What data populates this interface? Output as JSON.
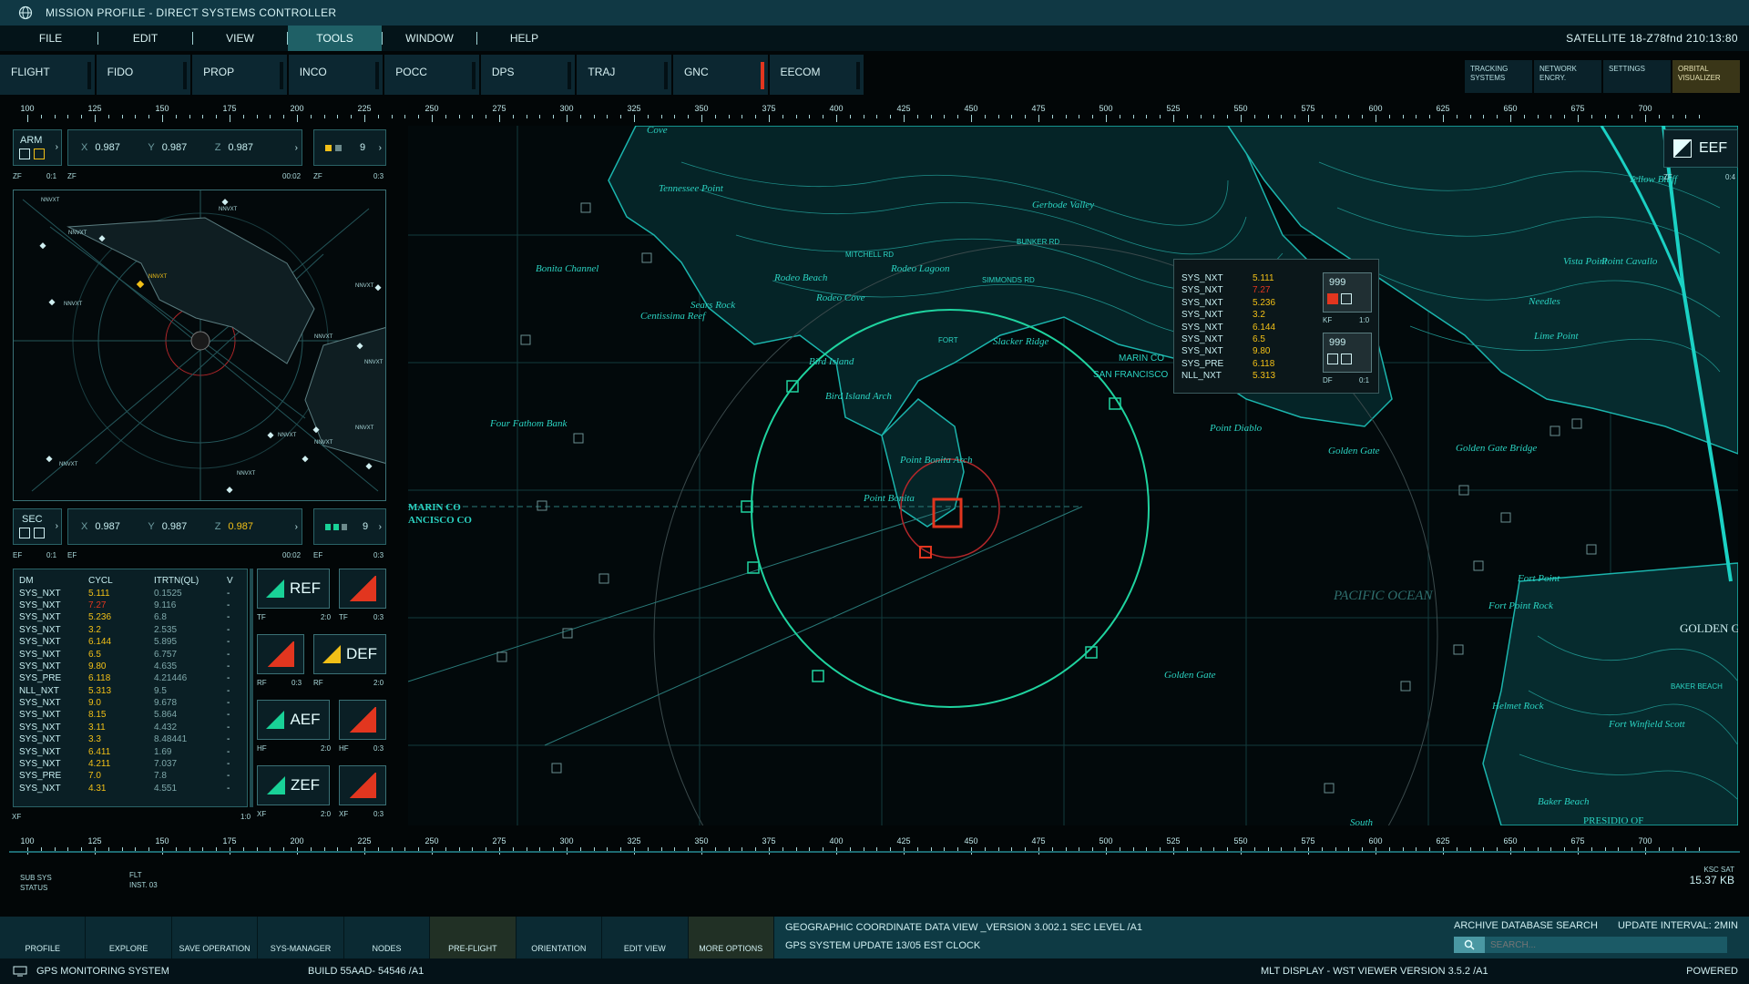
{
  "window": {
    "title": "MISSION PROFILE - DIRECT SYSTEMS CONTROLLER"
  },
  "menu": {
    "items": [
      {
        "label": "FILE"
      },
      {
        "label": "EDIT"
      },
      {
        "label": "VIEW"
      },
      {
        "label": "TOOLS",
        "active": true
      },
      {
        "label": "WINDOW"
      },
      {
        "label": "HELP"
      }
    ],
    "satellite": "SATELLITE  18-Z78fnd 210:13:80"
  },
  "departments": [
    {
      "label": "FLIGHT"
    },
    {
      "label": "FIDO"
    },
    {
      "label": "PROP"
    },
    {
      "label": "INCO"
    },
    {
      "label": "POCC"
    },
    {
      "label": "DPS"
    },
    {
      "label": "TRAJ"
    },
    {
      "label": "GNC",
      "alert": true
    },
    {
      "label": "EECOM"
    }
  ],
  "right_tabs": [
    {
      "line1": "TRACKING",
      "line2": "SYSTEMS"
    },
    {
      "line1": "NETWORK",
      "line2": "ENCRY."
    },
    {
      "line1": "SETTINGS",
      "line2": ""
    },
    {
      "line1": "ORBITAL",
      "line2": "VISUALIZER"
    }
  ],
  "ruler_labels": [
    "100",
    "125",
    "150",
    "175",
    "200",
    "225",
    "250",
    "275",
    "300",
    "325",
    "350",
    "375",
    "400",
    "425",
    "450",
    "475",
    "500",
    "525",
    "550",
    "575",
    "600",
    "625",
    "650",
    "675",
    "700"
  ],
  "arm": {
    "label": "ARM",
    "x_label": "X",
    "x": "0.987",
    "y_label": "Y",
    "y": "0.987",
    "z_label": "Z",
    "z": "0.987",
    "count": "9",
    "sub": {
      "a": "ZF",
      "b": "0:1",
      "c": "ZF",
      "d": "00:02",
      "e": "ZF",
      "f": "0:3"
    }
  },
  "sec": {
    "label": "SEC",
    "x_label": "X",
    "x": "0.987",
    "y_label": "Y",
    "y": "0.987",
    "z_label": "Z",
    "z": "0.987",
    "count": "9",
    "sub": {
      "a": "EF",
      "b": "0:1",
      "c": "EF",
      "d": "00:02",
      "e": "EF",
      "f": "0:3"
    }
  },
  "radar_tags": [
    "NNVXT",
    "NNVXT",
    "NNVXT",
    "NNVXT",
    "NNVXT",
    "NNVXT",
    "NNVXT",
    "NNVXT",
    "NNVXT",
    "NNVXT",
    "NNVXT",
    "NNVXT",
    "NNVXT"
  ],
  "dm_table": {
    "headers": [
      "DM",
      "CYCL",
      "ITRTN(QL)",
      "V"
    ],
    "rows": [
      [
        "SYS_NXT",
        "5.111",
        "0.1525",
        "-"
      ],
      [
        "SYS_NXT",
        "7.27",
        "9.116",
        "-"
      ],
      [
        "SYS_NXT",
        "5.236",
        "6.8",
        "-"
      ],
      [
        "SYS_NXT",
        "3.2",
        "2.535",
        "-"
      ],
      [
        "SYS_NXT",
        "6.144",
        "5.895",
        "-"
      ],
      [
        "SYS_NXT",
        "6.5",
        "6.757",
        "-"
      ],
      [
        "SYS_NXT",
        "9.80",
        "4.635",
        "-"
      ],
      [
        "SYS_PRE",
        "6.118",
        "4.21446",
        "-"
      ],
      [
        "NLL_NXT",
        "5.313",
        "9.5",
        "-"
      ],
      [
        "SYS_NXT",
        "9.0",
        "9.678",
        "-"
      ],
      [
        "SYS_NXT",
        "8.15",
        "5.864",
        "-"
      ],
      [
        "SYS_NXT",
        "3.11",
        "4.432",
        "-"
      ],
      [
        "SYS_NXT",
        "3.3",
        "8.48441",
        "-"
      ],
      [
        "SYS_NXT",
        "6.411",
        "1.69",
        "-"
      ],
      [
        "SYS_NXT",
        "4.211",
        "7.037",
        "-"
      ],
      [
        "SYS_PRE",
        "7.0",
        "7.8",
        "-"
      ],
      [
        "SYS_NXT",
        "4.31",
        "4.551",
        "-"
      ]
    ],
    "red_row": 1,
    "footer": {
      "left": "XF",
      "right": "1:0"
    }
  },
  "ref_buttons": [
    {
      "label": "REF",
      "tag1": "TF",
      "t1": "2:0",
      "tag2": "TF",
      "t2": "0:3",
      "color": "green"
    },
    {
      "label": "DEF",
      "tag1": "RF",
      "t1": "0:3",
      "tag2": "RF",
      "t2": "2:0",
      "color": "gold"
    },
    {
      "label": "AEF",
      "tag1": "HF",
      "t1": "2:0",
      "tag2": "HF",
      "t2": "0:3",
      "color": "green"
    },
    {
      "label": "ZEF",
      "tag1": "XF",
      "t1": "2:0",
      "tag2": "XF",
      "t2": "0:3",
      "color": "green"
    }
  ],
  "map": {
    "places": [
      "Tennessee Point",
      "Gerbode Valley",
      "Bonita Channel",
      "Rodeo Beach",
      "Rodeo Lagoon",
      "Rodeo Cove",
      "Sears Rock",
      "Centissima Reef",
      "Bird Island",
      "Bird Island Arch",
      "Four Fathom Bank",
      "Point Bonita Arch",
      "Point Bonita",
      "Point Diablo",
      "Golden Gate",
      "Golden Gate Bridge",
      "PACIFIC OCEAN",
      "Fort Point",
      "Fort Point Rock",
      "Helmet Rock",
      "Fort Winfield Scott",
      "Baker Beach",
      "Vista Point",
      "Point Cavallo",
      "Yellow Bluff",
      "Needles",
      "Lime Point",
      "Slacker Ridge",
      "Golden Gate",
      "South",
      "PRESIDIO OF",
      "MARIN CO",
      "ANCISCO CO",
      "Cove"
    ],
    "roads": [
      "MITCHELL RD",
      "BUNKER RD",
      "SIMMONDS RD",
      "FORT",
      "MARIN CO",
      "SAN FRANCISCO",
      "BAKER BEACH"
    ],
    "golden_gate_right": "GOLDEN GA RECREA",
    "eef_label": "EEF",
    "eef_sub": {
      "a": "ZF",
      "b": "0:4"
    }
  },
  "popup": {
    "rows": [
      {
        "k": "SYS_NXT",
        "v": "5.111",
        "red": false
      },
      {
        "k": "SYS_NXT",
        "v": "7.27",
        "red": true
      },
      {
        "k": "SYS_NXT",
        "v": "5.236",
        "red": false
      },
      {
        "k": "SYS_NXT",
        "v": "3.2",
        "red": false
      },
      {
        "k": "SYS_NXT",
        "v": "6.144",
        "red": false
      },
      {
        "k": "SYS_NXT",
        "v": "6.5",
        "red": false
      },
      {
        "k": "SYS_NXT",
        "v": "9.80",
        "red": false
      },
      {
        "k": "SYS_PRE",
        "v": "6.118",
        "red": false
      },
      {
        "k": "NLL_NXT",
        "v": "5.313",
        "red": false
      }
    ],
    "box1": {
      "value": "999",
      "tag": "KF",
      "ratio": "1:0"
    },
    "box2": {
      "value": "999",
      "tag": "DF",
      "ratio": "0:1"
    }
  },
  "lower": {
    "sub_sys": "SUB SYS",
    "status": "STATUS",
    "flt": "FLT",
    "inst": "INST. 03",
    "ksc_sat": "KSC SAT",
    "size": "15.37 KB"
  },
  "bottom_tabs": [
    {
      "label": "PROFILE"
    },
    {
      "label": "EXPLORE"
    },
    {
      "label": "SAVE OPERATION"
    },
    {
      "label": "SYS-MANAGER"
    },
    {
      "label": "NODES"
    },
    {
      "label": "PRE-FLIGHT",
      "hl": true
    },
    {
      "label": "ORIENTATION"
    },
    {
      "label": "EDIT VIEW"
    },
    {
      "label": "MORE OPTIONS",
      "hl": true
    }
  ],
  "info": {
    "line1": "GEOGRAPHIC COORDINATE DATA VIEW  _VERSION 3.002.1 SEC LEVEL /A1",
    "line2": "GPS SYSTEM UPDATE 13/05 EST CLOCK",
    "archive": "ARCHIVE DATABASE SEARCH",
    "update": "UPDATE INTERVAL: 2MIN",
    "search_placeholder": "SEARCH..."
  },
  "statusbar": {
    "app": "GPS MONITORING SYSTEM",
    "build": "BUILD 55AAD- 54546  /A1",
    "display": "MLT  DISPLAY - WST VIEWER  VERSION 3.5.2 /A1",
    "powered": "POWERED"
  }
}
